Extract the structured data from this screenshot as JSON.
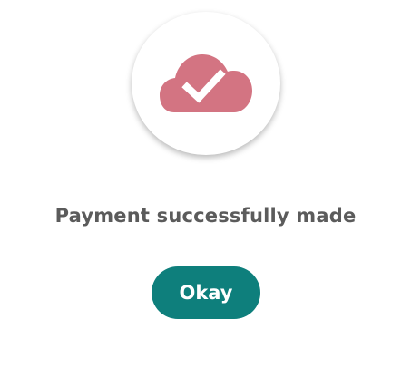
{
  "dialog": {
    "icon": "cloud-check-icon",
    "message": "Payment successfully made",
    "button_label": "Okay"
  },
  "colors": {
    "icon": "#d37482",
    "button": "#0e7f7c",
    "message_text": "#5b5b5b",
    "background": "#ffffff"
  }
}
